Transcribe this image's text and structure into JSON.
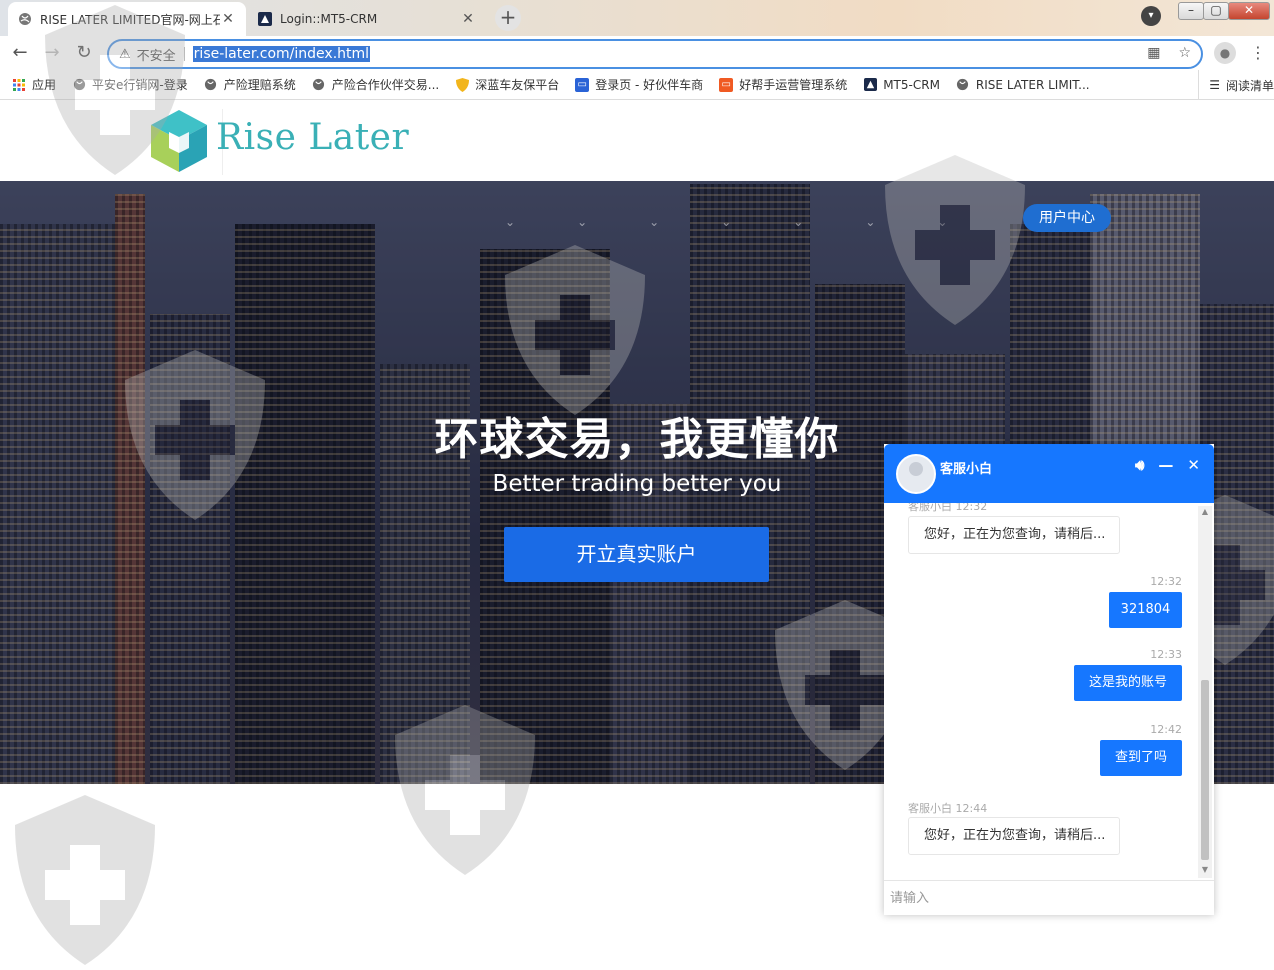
{
  "browser": {
    "tabs": [
      {
        "title": "RISE LATER LIMITED官网-网上石",
        "active": true,
        "icon": "globe-icon"
      },
      {
        "title": "Login::MT5-CRM",
        "active": false,
        "icon": "mt5-icon"
      }
    ],
    "new_tab": "+",
    "address": {
      "security_label": "不安全",
      "url": "rise-later.com/index.html"
    },
    "bookmarks": [
      {
        "label": "应用",
        "icon": "apps-grid-icon"
      },
      {
        "label": "平安e行销网-登录",
        "icon": "globe-icon"
      },
      {
        "label": "产险理赔系统",
        "icon": "globe-icon"
      },
      {
        "label": "产险合作伙伴交易...",
        "icon": "globe-icon"
      },
      {
        "label": "深蓝车友保平台",
        "icon": "shield-icon"
      },
      {
        "label": "登录页 - 好伙伴车商",
        "icon": "site-icon"
      },
      {
        "label": "好帮手运营管理系统",
        "icon": "site-icon"
      },
      {
        "label": "MT5-CRM",
        "icon": "mt5-icon"
      },
      {
        "label": "RISE LATER LIMIT...",
        "icon": "globe-icon"
      }
    ],
    "reading_list": "阅读清单"
  },
  "site": {
    "logo_text": "Rise Later",
    "nav_user_center": "用户中心",
    "hero_title": "环球交易，我更懂你",
    "hero_subtitle": "Better trading better you",
    "cta_label": "开立真实账户"
  },
  "chat": {
    "agent_name": "客服小白",
    "messages": [
      {
        "from": "agent",
        "meta": "客服小白 12:32",
        "text": "您好，正在为您查询，请稍后..."
      },
      {
        "from": "user",
        "time": "12:32",
        "text": "321804"
      },
      {
        "from": "user",
        "time": "12:33",
        "text": "这是我的账号"
      },
      {
        "from": "user",
        "time": "12:42",
        "text": "查到了吗"
      },
      {
        "from": "agent",
        "meta": "客服小白 12:44",
        "text": "您好，正在为您查询，请稍后..."
      }
    ],
    "input_placeholder": "请输入"
  },
  "colors": {
    "brand_teal": "#3ab0b6",
    "primary_blue": "#1677ff",
    "cta_blue": "#1a6be6"
  }
}
